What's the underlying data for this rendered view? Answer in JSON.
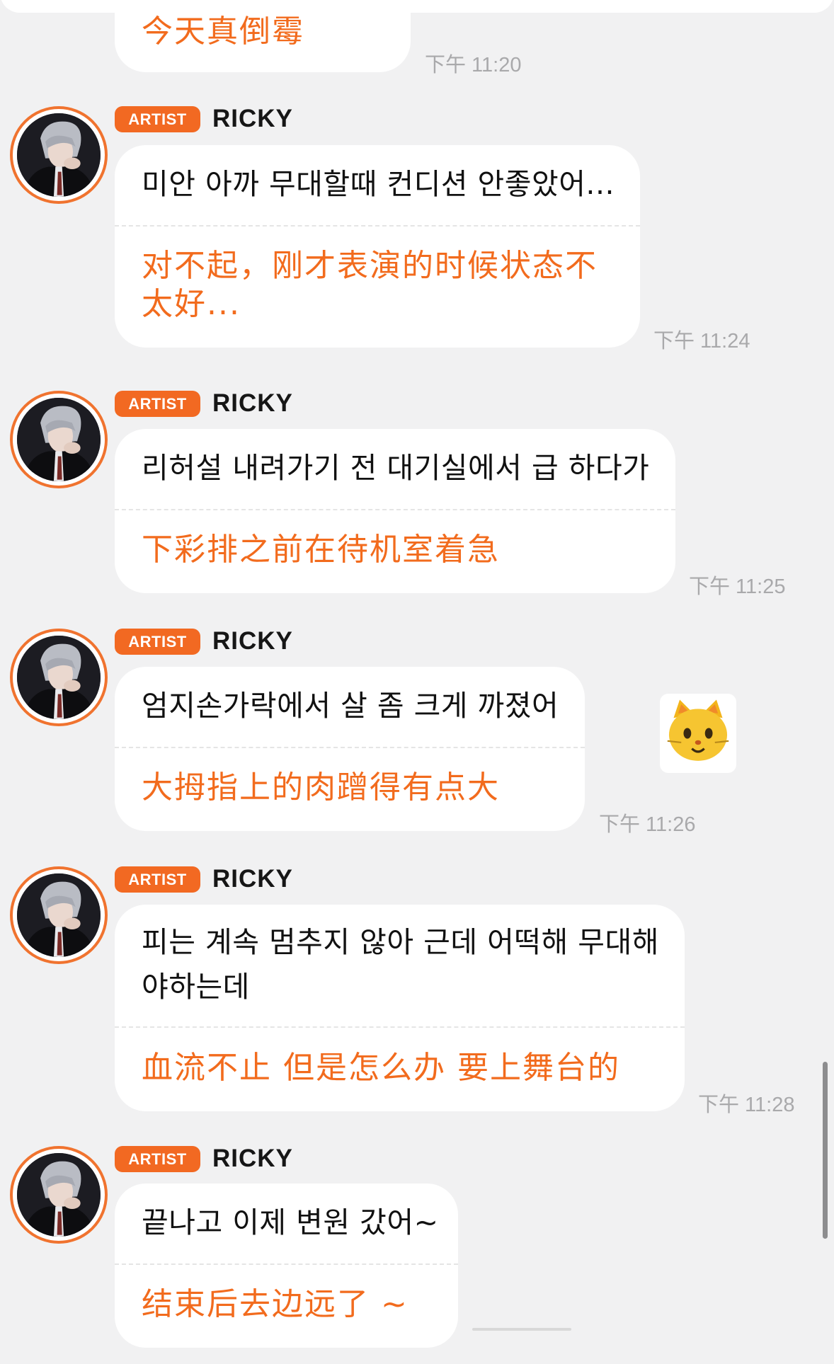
{
  "top_message": {
    "translation": "今天真倒霉",
    "time": "下午 11:20"
  },
  "messages": [
    {
      "badge": "ARTIST",
      "sender": "RICKY",
      "korean": "미안 아까 무대할때 컨디션 안좋았어...",
      "translation": "对不起，刚才表演的时候状态不太好...",
      "time": "下午 11:24"
    },
    {
      "badge": "ARTIST",
      "sender": "RICKY",
      "korean": "리허설 내려가기 전 대기실에서 급 하다가",
      "translation": "下彩排之前在待机室着急",
      "time": "下午 11:25"
    },
    {
      "badge": "ARTIST",
      "sender": "RICKY",
      "korean": "엄지손가락에서 살 좀 크게 까졌어",
      "translation": "大拇指上的肉蹭得有点大",
      "time": "下午 11:26",
      "reaction": "cat-emoji"
    },
    {
      "badge": "ARTIST",
      "sender": "RICKY",
      "korean": "피는 계속 멈추지 않아 근데 어떡해 무대해야하는데",
      "translation": "血流不止 但是怎么办 要上舞台的",
      "time": "下午 11:28"
    },
    {
      "badge": "ARTIST",
      "sender": "RICKY",
      "korean": "끝나고 이제 변원 갔어~",
      "translation": "结束后去边远了 ~"
    }
  ],
  "colors": {
    "accent": "#f26922",
    "translation": "#f26b1d",
    "background": "#f1f1f2",
    "timestamp": "#a9a9ab"
  }
}
